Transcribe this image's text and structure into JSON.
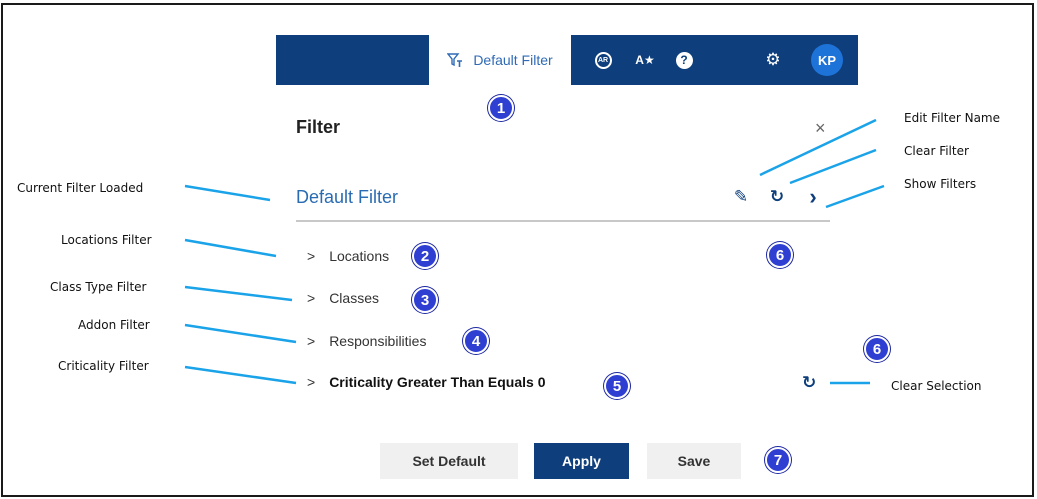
{
  "topbar": {
    "filter_tab_label": "Default Filter",
    "filter_icon": "filter-icon",
    "ar_label": "AR",
    "az_label": "A★",
    "help_label": "?",
    "gear_label": "⚙",
    "avatar_initials": "KP"
  },
  "panel": {
    "title": "Filter",
    "close_label": "×",
    "current_filter": "Default Filter",
    "edit_icon": "✎",
    "clear_icon": "↻",
    "show_icon": "›"
  },
  "filters": [
    {
      "label": "Locations"
    },
    {
      "label": "Classes"
    },
    {
      "label": "Responsibilities"
    },
    {
      "label": "Criticality Greater Than Equals 0"
    }
  ],
  "clear_selection_icon": "↻",
  "buttons": {
    "set_default": "Set Default",
    "apply": "Apply",
    "save": "Save"
  },
  "badges": [
    "1",
    "2",
    "3",
    "4",
    "5",
    "6",
    "6",
    "7"
  ],
  "annotations": {
    "current_filter_loaded": "Current Filter Loaded",
    "locations_filter": "Locations Filter",
    "class_type_filter": "Class Type Filter",
    "addon_filter": "Addon Filter",
    "criticality_filter": "Criticality Filter",
    "edit_filter_name": "Edit Filter Name",
    "clear_filter": "Clear Filter",
    "show_filters": "Show Filters",
    "clear_selection": "Clear Selection"
  },
  "colors": {
    "navy": "#0e3f7c",
    "link_blue": "#2a6cb3",
    "badge_blue": "#2f3fd1",
    "annotation_line": "#1aa3e8"
  }
}
